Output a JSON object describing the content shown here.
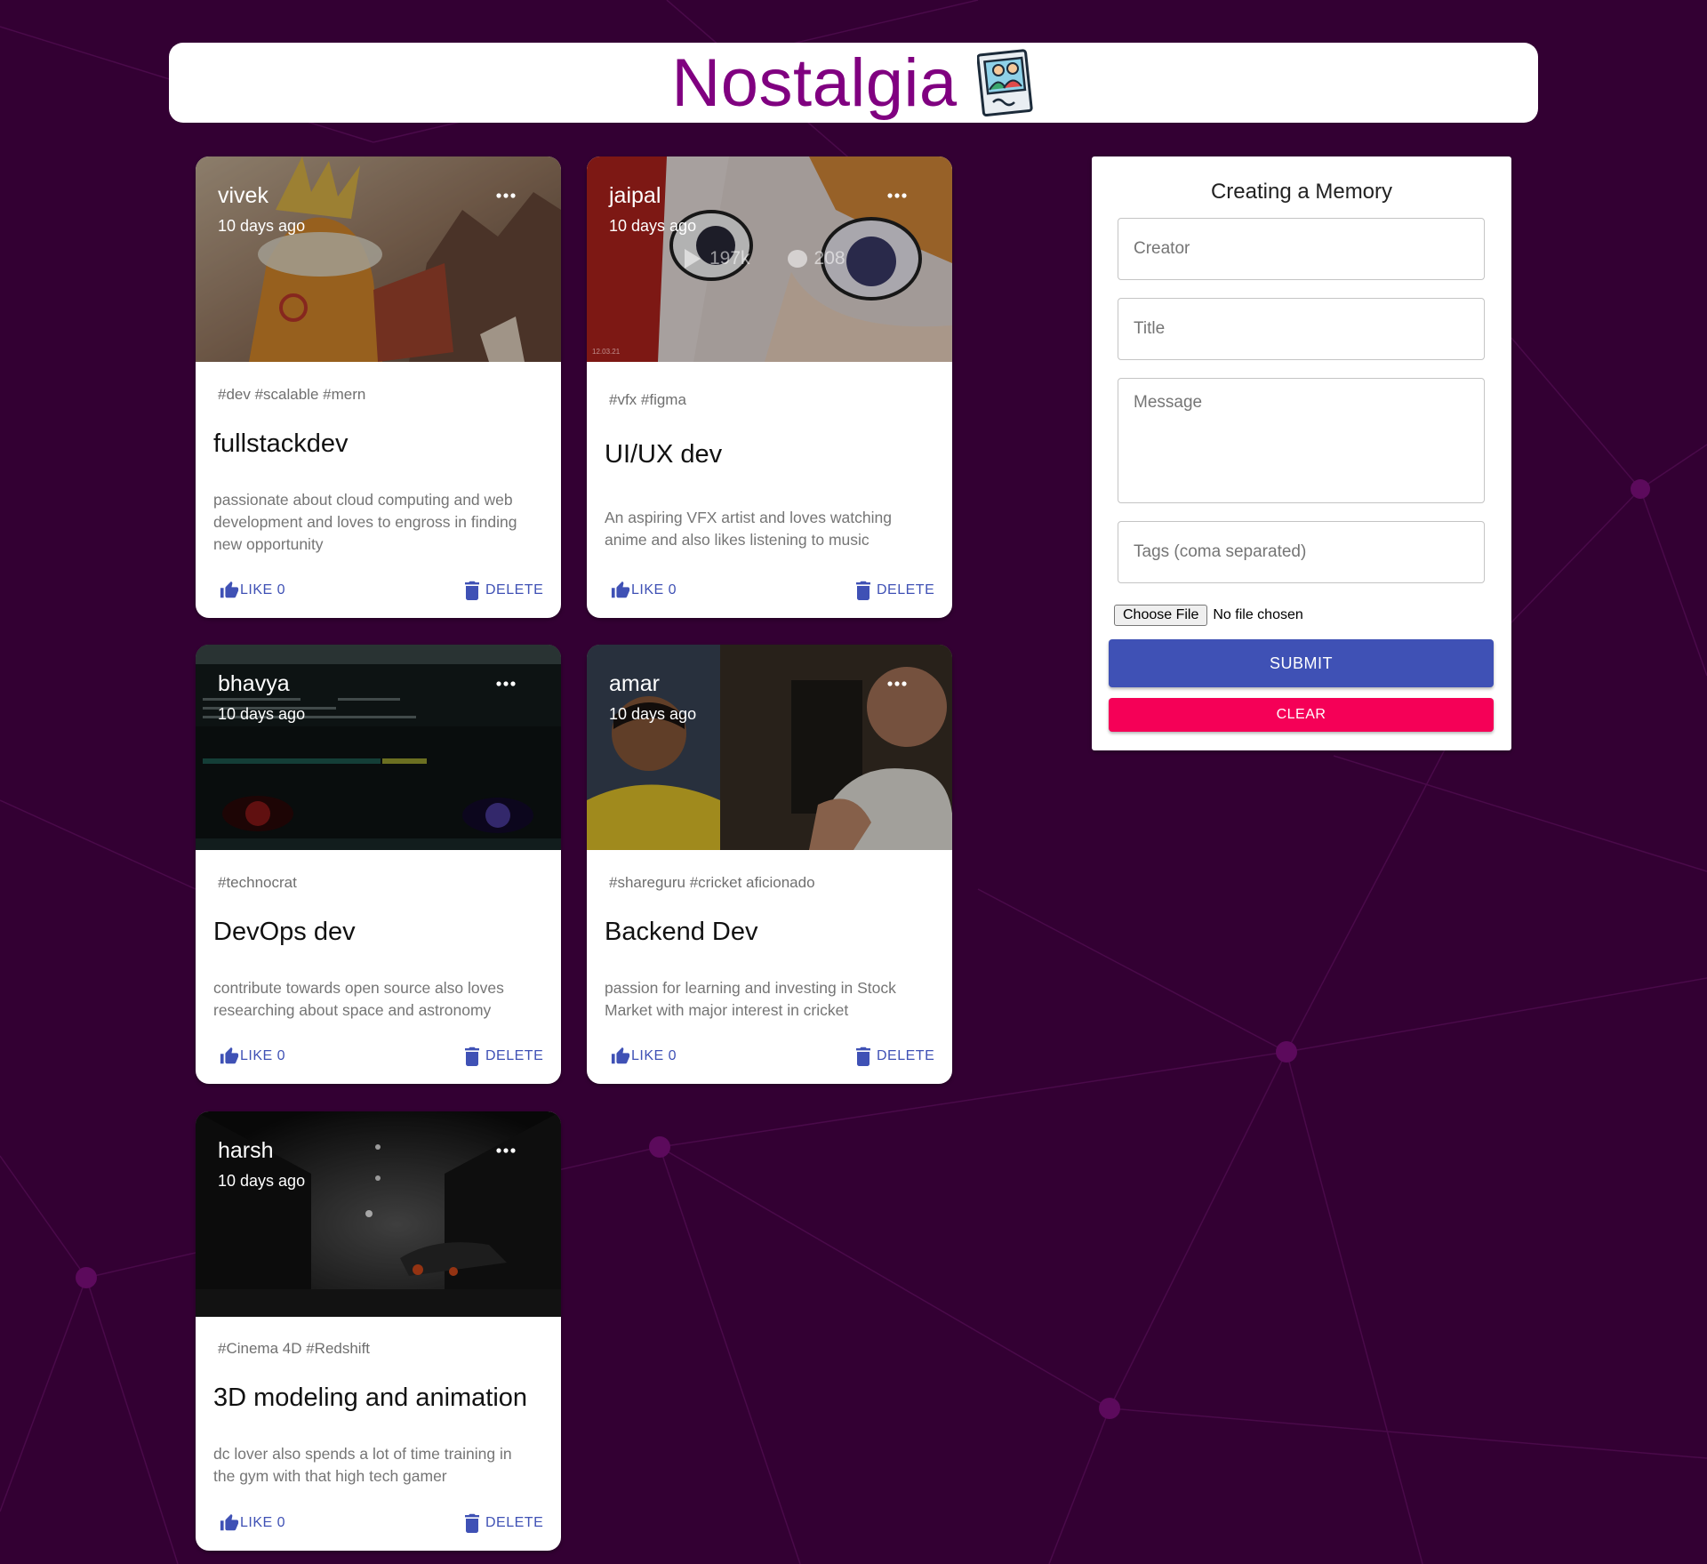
{
  "app": {
    "title": "Nostalgia",
    "logo_icon": "photo-memories-icon",
    "title_color": "#800080"
  },
  "background": {
    "color": "#330033",
    "line_color": "#4a0a4a",
    "node_color": "#5c0a5c"
  },
  "posts": [
    {
      "creator": "vivek",
      "time": "10 days ago",
      "tags": "#dev #scalable #mern",
      "title": "fullstackdev",
      "message": "passionate about cloud computing and web development and loves to engross in finding new opportunity",
      "like_label": "LIKE 0",
      "delete_label": "DELETE"
    },
    {
      "creator": "jaipal",
      "time": "10 days ago",
      "tags": "#vfx #figma",
      "title": "UI/UX dev",
      "message": "An aspiring VFX artist and loves watching anime and also likes listening to music",
      "like_label": "LIKE 0",
      "delete_label": "DELETE"
    },
    {
      "creator": "bhavya",
      "time": "10 days ago",
      "tags": "#technocrat",
      "title": "DevOps dev",
      "message": "contribute towards open source also loves researching about space and astronomy",
      "like_label": "LIKE 0",
      "delete_label": "DELETE"
    },
    {
      "creator": "amar",
      "time": "10 days ago",
      "tags": "#shareguru #cricket aficionado",
      "title": "Backend Dev",
      "message": "passion for learning and investing in Stock Market with major interest in cricket",
      "like_label": "LIKE 0",
      "delete_label": "DELETE"
    },
    {
      "creator": "harsh",
      "time": "10 days ago",
      "tags": "#Cinema 4D #Redshift",
      "title": "3D modeling and animation",
      "message": "dc lover also spends a lot of time training in the gym with that high tech gamer",
      "like_label": "LIKE 0",
      "delete_label": "DELETE"
    }
  ],
  "media_overlay_text": {
    "views": "197k",
    "comments": "208",
    "date_stamp": "12.03.21"
  },
  "form": {
    "heading": "Creating a Memory",
    "creator_placeholder": "Creator",
    "title_placeholder": "Title",
    "message_placeholder": "Message",
    "tags_placeholder": "Tags (coma separated)",
    "file_button": "Choose File",
    "file_status": "No file chosen",
    "submit_label": "SUBMIT",
    "clear_label": "CLEAR",
    "submit_color": "#3f51b5",
    "clear_color": "#f50057"
  }
}
